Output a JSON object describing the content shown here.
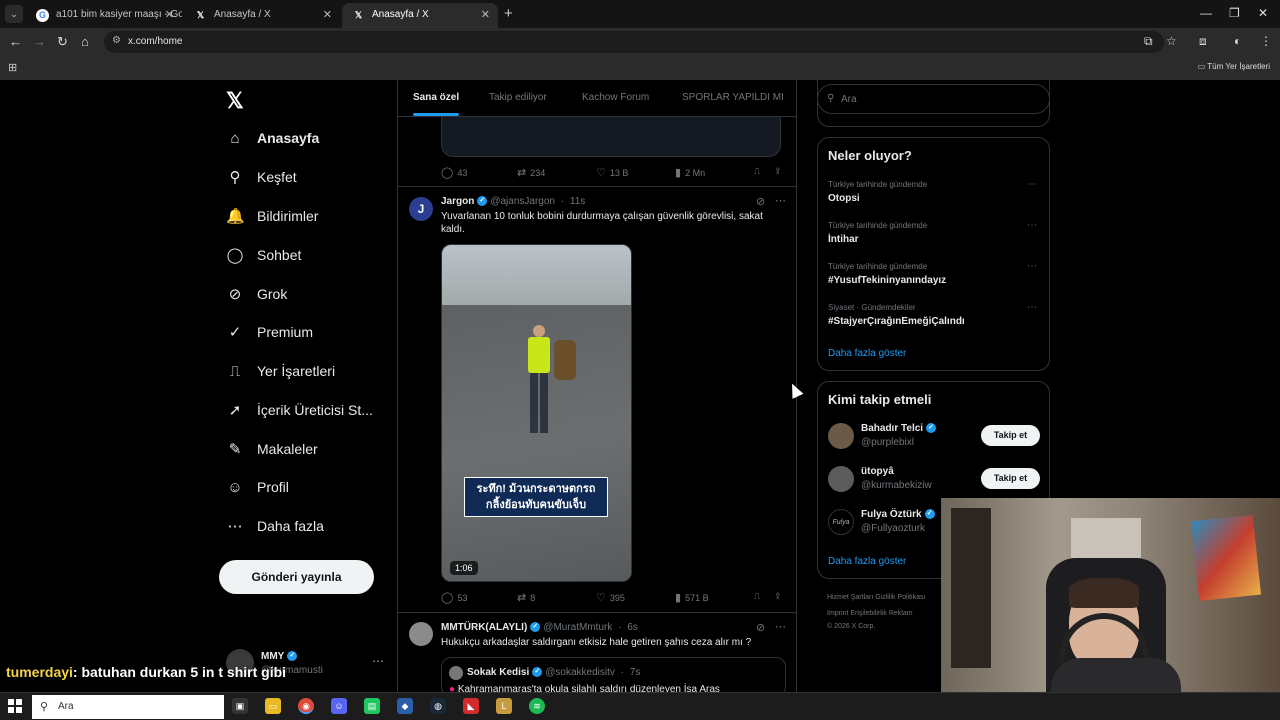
{
  "browser": {
    "tabs": [
      {
        "title": "a101 bim kasiyer maaşı - Google",
        "icon": "google-icon"
      },
      {
        "title": "Anasayfa / X",
        "icon": "x-icon"
      },
      {
        "title": "Anasayfa / X",
        "icon": "x-icon"
      }
    ],
    "url": "x.com/home",
    "bookmarks_all": "Tüm Yer İşaretleri"
  },
  "nav": {
    "items": [
      {
        "label": "Anasayfa",
        "icon": "home-icon",
        "glyph": "⌂"
      },
      {
        "label": "Keşfet",
        "icon": "search-icon",
        "glyph": "⚲"
      },
      {
        "label": "Bildirimler",
        "icon": "bell-icon",
        "glyph": "🔔"
      },
      {
        "label": "Sohbet",
        "icon": "chat-icon",
        "glyph": "◯"
      },
      {
        "label": "Grok",
        "icon": "grok-icon",
        "glyph": "⊘"
      },
      {
        "label": "Premium",
        "icon": "premium-icon",
        "glyph": "✓"
      },
      {
        "label": "Yer İşaretleri",
        "icon": "bookmark-icon",
        "glyph": "⎍"
      },
      {
        "label": "İçerik Üreticisi St...",
        "icon": "rocket-icon",
        "glyph": "➚"
      },
      {
        "label": "Makaleler",
        "icon": "article-icon",
        "glyph": "✎"
      },
      {
        "label": "Profil",
        "icon": "profile-icon",
        "glyph": "☺"
      },
      {
        "label": "Daha fazla",
        "icon": "more-icon",
        "glyph": "⋯"
      }
    ],
    "post_button": "Gönderi yayınla",
    "account": {
      "name": "MMY",
      "handle": "@kurmamusti"
    }
  },
  "feed": {
    "tabs": [
      "Sana özel",
      "Takip ediliyor",
      "Kachow Forum",
      "SPORLAR YAPILDI MI"
    ],
    "tweet0_actions": {
      "replies": "43",
      "retweets": "234",
      "likes": "13 B",
      "views": "2 Mn"
    },
    "tweet1": {
      "name": "Jargon",
      "handle": "@ajansJargon",
      "time": "11s",
      "text": "Yuvarlanan 10 tonluk bobini durdurmaya çalışan güvenlik görevlisi, sakat kaldı.",
      "video_caption": "ระทึก! ม้วนกระดาษตกรถ กลิ้งย้อนทับคนขับเจ็บ",
      "duration": "1:06",
      "actions": {
        "replies": "53",
        "retweets": "8",
        "likes": "395",
        "views": "571 B"
      }
    },
    "tweet2": {
      "name": "MMTÜRK(ALAYLI)",
      "handle": "@MuratMmturk",
      "time": "6s",
      "text": "Hukukçu arkadaşlar saldırganı etkisiz hale getiren şahıs ceza alır mı ?",
      "quote": {
        "name": "Sokak Kedisi",
        "handle": "@sokakkedisitv",
        "time": "7s",
        "text": "Kahramanmaraş'ta okula silahlı saldırı düzenleyen İsa Aras"
      }
    }
  },
  "right": {
    "search_placeholder": "Ara",
    "trends_title": "Neler oluyor?",
    "trends": [
      {
        "category": "Türkiye tarihinde gündemde",
        "name": "Otopsi"
      },
      {
        "category": "Türkiye tarihinde gündemde",
        "name": "İntihar"
      },
      {
        "category": "Türkiye tarihinde gündemde",
        "name": "#YusufTekininyanındayız"
      },
      {
        "category": "Siyaset · Gündemdekiler",
        "name": "#StajyerÇırağınEmeğiÇalındı"
      }
    ],
    "show_more": "Daha fazla göster",
    "wtf_title": "Kimi takip etmeli",
    "wtf": [
      {
        "name": "Bahadır Telci",
        "handle": "@purplebixl",
        "follow": "Takip et"
      },
      {
        "name": "ütopyâ",
        "handle": "@kurmabekiziw",
        "follow": "Takip et"
      },
      {
        "name": "Fulya Öztürk",
        "handle": "@Fullyaozturk"
      }
    ],
    "wtf_show_more": "Daha fazla göster",
    "footer": {
      "line1": "Hizmet Şartları   Gizlilik Politikası",
      "line2": "Imprint   Erişilebilirlik   Reklam",
      "line3": "© 2026 X Corp."
    }
  },
  "overlay": {
    "chat_user": "tumerdayi",
    "chat_message": ": batuhan durkan 5 in t shirt gibi"
  },
  "taskbar": {
    "search_placeholder": "Ara"
  }
}
